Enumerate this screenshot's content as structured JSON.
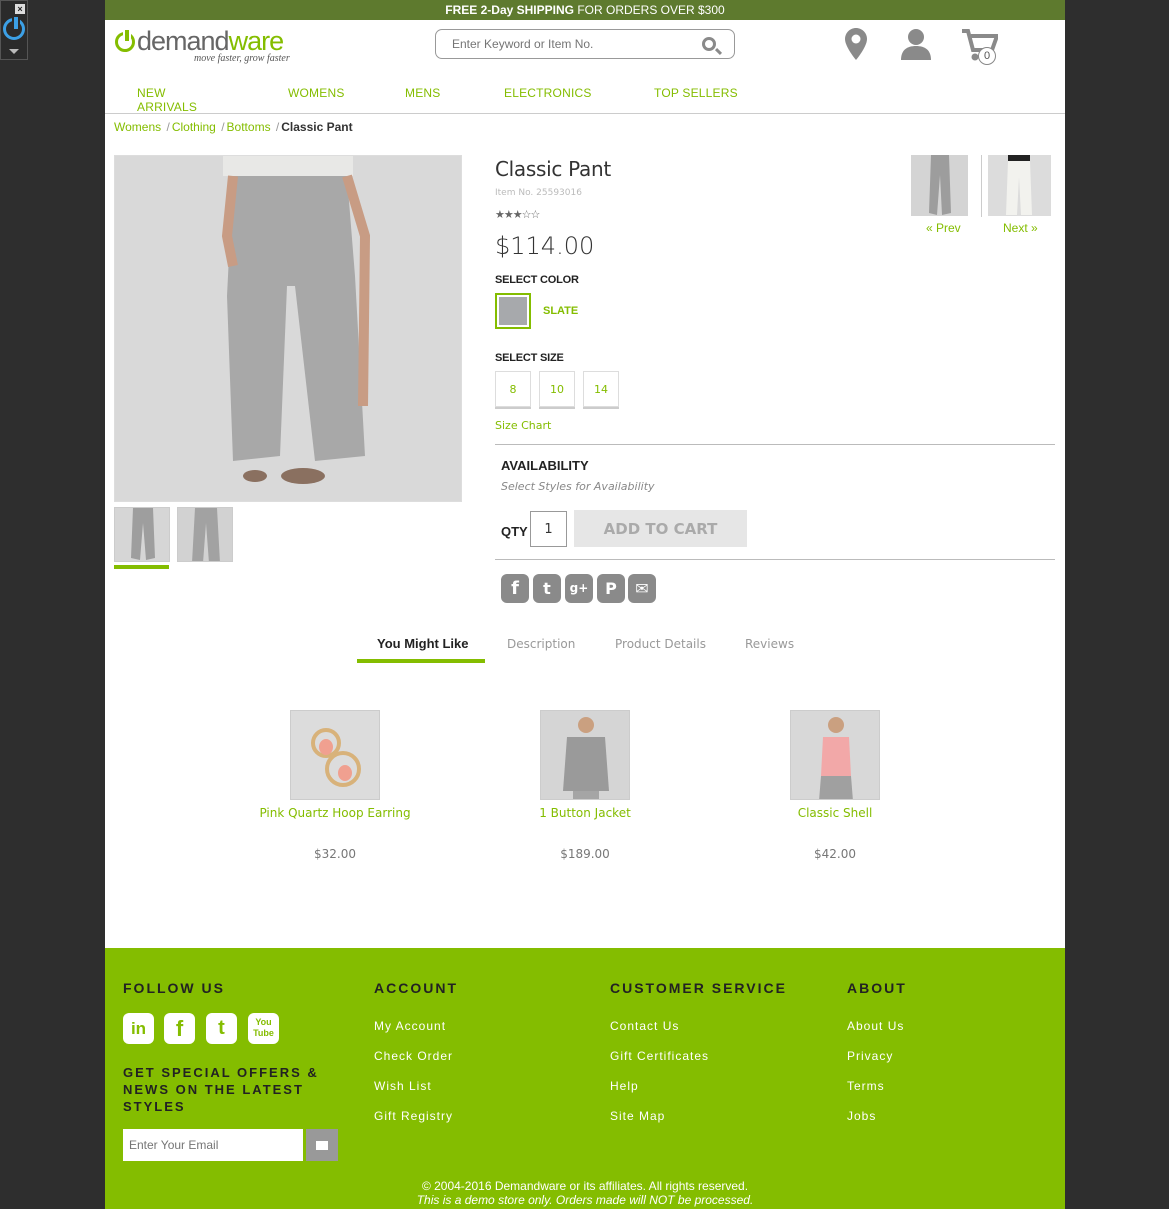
{
  "promo": {
    "bold": "FREE 2-Day SHIPPING",
    "rest": " FOR ORDERS OVER $300"
  },
  "logo": {
    "demand": "demand",
    "ware": "ware",
    "tagline": "move faster, grow faster"
  },
  "search": {
    "placeholder": "Enter Keyword or Item No."
  },
  "cart": {
    "count": "0"
  },
  "nav": [
    "NEW ARRIVALS",
    "WOMENS",
    "MENS",
    "ELECTRONICS",
    "TOP SELLERS"
  ],
  "breadcrumb": {
    "items": [
      "Womens",
      "Clothing",
      "Bottoms"
    ],
    "current": "Classic Pant",
    "separator": "/"
  },
  "product": {
    "name": "Classic Pant",
    "item_no": "Item No. 25593016",
    "rating_stars": "★★★☆☆",
    "rating": 2.5,
    "price": "$114.00",
    "select_color_label": "SELECT COLOR",
    "color": "SLATE",
    "color_hex": "#a7a9ac",
    "select_size_label": "SELECT SIZE",
    "sizes": [
      "8",
      "10",
      "14"
    ],
    "size_chart": "Size Chart",
    "availability_label": "AVAILABILITY",
    "availability_sub": "Select Styles for Availability",
    "qty_label": "QTY",
    "qty_value": "1",
    "add_to_cart": "ADD TO CART"
  },
  "prevnext": {
    "prev": "« Prev",
    "next": "Next »"
  },
  "share": {
    "facebook": "f",
    "twitter": "t",
    "googleplus": "g+",
    "pinterest": "P",
    "email": "✉"
  },
  "tabs": [
    "You Might Like",
    "Description",
    "Product Details",
    "Reviews"
  ],
  "recommendations": [
    {
      "name": "Pink Quartz Hoop Earring",
      "price": "$32.00"
    },
    {
      "name": "1 Button Jacket",
      "price": "$189.00"
    },
    {
      "name": "Classic Shell",
      "price": "$42.00"
    }
  ],
  "footer": {
    "follow_us": "FOLLOW US",
    "social": {
      "linkedin": "in",
      "facebook": "f",
      "twitter": "t",
      "youtube": "You Tube"
    },
    "offers": "GET SPECIAL OFFERS & NEWS ON THE LATEST STYLES",
    "email_placeholder": "Enter Your Email",
    "columns": [
      {
        "title": "ACCOUNT",
        "links": [
          "My Account",
          "Check Order",
          "Wish List",
          "Gift Registry"
        ]
      },
      {
        "title": "CUSTOMER SERVICE",
        "links": [
          "Contact Us",
          "Gift Certificates",
          "Help",
          "Site Map"
        ]
      },
      {
        "title": "ABOUT",
        "links": [
          "About Us",
          "Privacy",
          "Terms",
          "Jobs"
        ]
      }
    ],
    "copyright": "© 2004-2016 Demandware or its affiliates. All rights reserved.",
    "demo_note": "This is a demo store only. Orders made will NOT be processed."
  },
  "colors": {
    "brand_green": "#84bd00",
    "promo_bar": "#5e7a2e",
    "icon_gray": "#8a8a8a"
  }
}
